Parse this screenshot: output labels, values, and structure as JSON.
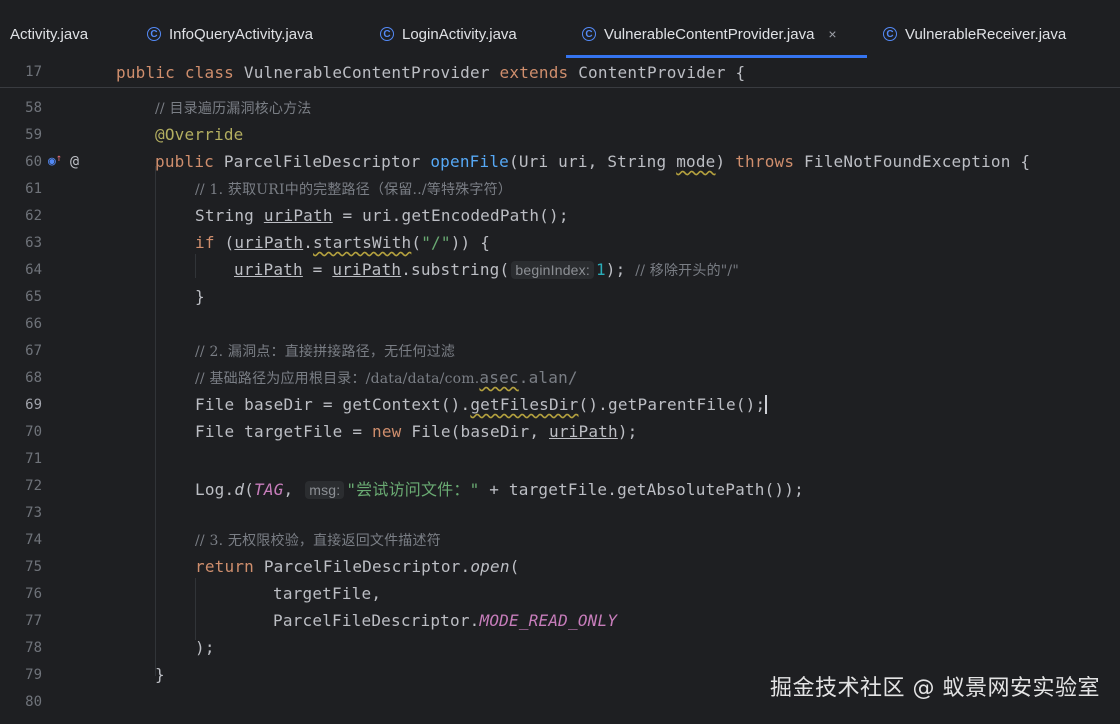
{
  "tabs": [
    {
      "label": "Activity.java",
      "icon": "none"
    },
    {
      "label": "InfoQueryActivity.java",
      "icon": "class-icon"
    },
    {
      "label": "LoginActivity.java",
      "icon": "class-icon"
    },
    {
      "label": "VulnerableContentProvider.java",
      "icon": "class-icon",
      "active": true
    },
    {
      "label": "VulnerableReceiver.java",
      "icon": "class-icon"
    }
  ],
  "tab_close": "×",
  "class_icon_glyph": "C",
  "sticky": {
    "line": "17",
    "text": [
      "public",
      "class",
      "VulnerableContentProvider",
      "extends",
      "ContentProvider {"
    ]
  },
  "gutter": [
    "58",
    "59",
    "60",
    "61",
    "62",
    "63",
    "64",
    "65",
    "66",
    "67",
    "68",
    "69",
    "70",
    "71",
    "72",
    "73",
    "74",
    "75",
    "76",
    "77",
    "78",
    "79",
    "80"
  ],
  "gutter_icons": {
    "override": "↑",
    "annotation": "@"
  },
  "code": {
    "l58": "// 目录遍历漏洞核心方法",
    "l59": "@Override",
    "l60": [
      "public",
      "ParcelFileDescriptor",
      "openFile",
      "(Uri uri, String ",
      "mode",
      ") ",
      "throws",
      " FileNotFoundException {"
    ],
    "l61": "// 1. 获取URI中的完整路径（保留../等特殊字符）",
    "l62": [
      "String ",
      "uriPath",
      " = uri.getEncodedPath();"
    ],
    "l63": [
      "if",
      " (",
      "uriPath",
      ".",
      "startsWith",
      "(",
      "\"/\"",
      ")) {"
    ],
    "l64": [
      "uriPath",
      " = ",
      "uriPath",
      ".substring(",
      "beginIndex:",
      "1",
      "); ",
      "// 移除开头的\"/\""
    ],
    "l65": "}",
    "l67": "// 2. 漏洞点：直接拼接路径，无任何过滤",
    "l68": [
      "// 基础路径为应用根目录：/data/data/com.",
      "asec",
      ".alan/"
    ],
    "l69": [
      "File baseDir = getContext().",
      "getFilesDir",
      "().getParentFile();"
    ],
    "l70": [
      "File targetFile = ",
      "new",
      " File(baseDir, ",
      "uriPath",
      ");"
    ],
    "l72": [
      "Log.",
      "d",
      "(",
      "TAG",
      ", ",
      "msg:",
      "\"尝试访问文件：\"",
      " + targetFile.getAbsolutePath());"
    ],
    "l74": "// 3. 无权限校验，直接返回文件描述符",
    "l75": [
      "return",
      " ParcelFileDescriptor.",
      "open",
      "("
    ],
    "l76": "targetFile,",
    "l77": [
      "ParcelFileDescriptor.",
      "MODE_READ_ONLY"
    ],
    "l78": ");",
    "l79": "}"
  },
  "watermark": "掘金技术社区 @ 蚁景网安实验室"
}
